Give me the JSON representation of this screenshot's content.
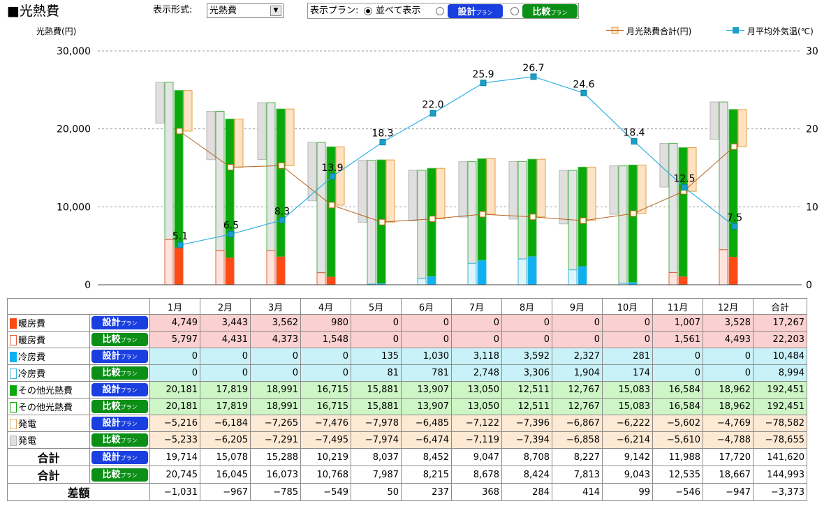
{
  "title": "■光熱費",
  "controls": {
    "display_format_label": "表示形式:",
    "display_format_value": "光熱費",
    "plan_label": "表示プラン:",
    "side_by_side_label": "並べて表示",
    "plan_design_main": "設計",
    "plan_compare_main": "比較",
    "plan_suffix": "プラン"
  },
  "chart_data": {
    "type": "bar",
    "ylabel": "光熱費(円)",
    "ylim": [
      0,
      30000
    ],
    "y2lim": [
      0,
      30
    ],
    "yticks": [
      "0",
      "10,000",
      "20,000",
      "30,000"
    ],
    "y2ticks": [
      "0",
      "10",
      "20",
      "30"
    ],
    "categories": [
      "1月",
      "2月",
      "3月",
      "4月",
      "5月",
      "6月",
      "7月",
      "8月",
      "9月",
      "10月",
      "11月",
      "12月"
    ],
    "legend": {
      "total": "月光熱費合計(円)",
      "temp": "月平均外気温(℃)",
      "position": "top-right"
    },
    "stacks": {
      "compare": {
        "heating": [
          5797,
          4431,
          4373,
          1548,
          0,
          0,
          0,
          0,
          0,
          0,
          1561,
          4493
        ],
        "cooling": [
          0,
          0,
          0,
          0,
          81,
          781,
          2748,
          3306,
          1904,
          174,
          0,
          0
        ],
        "other": [
          20181,
          17819,
          18991,
          16715,
          15881,
          13907,
          13050,
          12511,
          12767,
          15083,
          16584,
          18962
        ],
        "generation": [
          -5233,
          -6205,
          -7291,
          -7495,
          -7974,
          -6474,
          -7119,
          -7394,
          -6858,
          -6214,
          -5610,
          -4788
        ]
      },
      "design": {
        "heating": [
          4749,
          3443,
          3562,
          980,
          0,
          0,
          0,
          0,
          0,
          0,
          1007,
          3528
        ],
        "cooling": [
          0,
          0,
          0,
          0,
          135,
          1030,
          3118,
          3592,
          2327,
          281,
          0,
          0
        ],
        "other": [
          20181,
          17819,
          18991,
          16715,
          15881,
          13907,
          13050,
          12511,
          12767,
          15083,
          16584,
          18962
        ],
        "generation": [
          -5216,
          -6184,
          -7265,
          -7476,
          -7978,
          -6485,
          -7122,
          -7396,
          -6867,
          -6222,
          -5602,
          -4769
        ]
      }
    },
    "monthly_total_design": [
      19714,
      15078,
      15288,
      10219,
      8037,
      8452,
      9047,
      8708,
      8227,
      9142,
      11988,
      17720
    ],
    "monthly_total_compare": [
      20745,
      16045,
      16073,
      10768,
      7987,
      8215,
      8678,
      8424,
      7813,
      9043,
      12535,
      18667
    ],
    "temperature": [
      5.1,
      6.5,
      8.3,
      13.9,
      18.3,
      22.0,
      25.9,
      26.7,
      24.6,
      18.4,
      12.5,
      7.5
    ],
    "temperature_labels": [
      "5.1",
      "6.5",
      "8.3",
      "13.9",
      "18.3",
      "22.0",
      "25.9",
      "26.7",
      "24.6",
      "18.4",
      "12.5",
      "7.5"
    ],
    "grid": "horizontal dashed"
  },
  "colors": {
    "heating_design": "#ff4a14",
    "heating_compare": "#ffe3dc",
    "heating_compare_border": "#e0603a",
    "cooling_design": "#0fb0f0",
    "cooling_compare": "#dff4fb",
    "cooling_compare_border": "#39b6e0",
    "other_design": "#0aa80a",
    "other_compare": "#e4e4e4",
    "other_compare_border": "#48b848",
    "gen_design": "#fde2c3",
    "gen_design_border": "#e4a040",
    "gen_compare": "#e0dede",
    "gen_compare_border": "#b8b8b8",
    "total_line": "#b8631e",
    "temp_line": "#2fb0e4",
    "temp_marker": "#1aa0c8"
  },
  "table": {
    "headers": [
      "1月",
      "2月",
      "3月",
      "4月",
      "5月",
      "6月",
      "7月",
      "8月",
      "9月",
      "10月",
      "11月",
      "12月",
      "合計"
    ],
    "rows": [
      {
        "kind": "heat",
        "label": "暖房費",
        "swatch": "filled",
        "plan": "design",
        "values": [
          "4,749",
          "3,443",
          "3,562",
          "980",
          "0",
          "0",
          "0",
          "0",
          "0",
          "0",
          "1,007",
          "3,528",
          "17,267"
        ]
      },
      {
        "kind": "heat",
        "label": "暖房費",
        "swatch": "hollow",
        "plan": "compare",
        "values": [
          "5,797",
          "4,431",
          "4,373",
          "1,548",
          "0",
          "0",
          "0",
          "0",
          "0",
          "0",
          "1,561",
          "4,493",
          "22,203"
        ]
      },
      {
        "kind": "cool",
        "label": "冷房費",
        "swatch": "filled",
        "plan": "design",
        "values": [
          "0",
          "0",
          "0",
          "0",
          "135",
          "1,030",
          "3,118",
          "3,592",
          "2,327",
          "281",
          "0",
          "0",
          "10,484"
        ]
      },
      {
        "kind": "cool",
        "label": "冷房費",
        "swatch": "hollow",
        "plan": "compare",
        "values": [
          "0",
          "0",
          "0",
          "0",
          "81",
          "781",
          "2,748",
          "3,306",
          "1,904",
          "174",
          "0",
          "0",
          "8,994"
        ]
      },
      {
        "kind": "other",
        "label": "その他光熱費",
        "swatch": "filled",
        "plan": "design",
        "values": [
          "20,181",
          "17,819",
          "18,991",
          "16,715",
          "15,881",
          "13,907",
          "13,050",
          "12,511",
          "12,767",
          "15,083",
          "16,584",
          "18,962",
          "192,451"
        ]
      },
      {
        "kind": "other",
        "label": "その他光熱費",
        "swatch": "hollow",
        "plan": "compare",
        "values": [
          "20,181",
          "17,819",
          "18,991",
          "16,715",
          "15,881",
          "13,907",
          "13,050",
          "12,511",
          "12,767",
          "15,083",
          "16,584",
          "18,962",
          "192,451"
        ]
      },
      {
        "kind": "gen",
        "label": "発電",
        "swatch": "hollow",
        "plan": "design",
        "values": [
          "−5,216",
          "−6,184",
          "−7,265",
          "−7,476",
          "−7,978",
          "−6,485",
          "−7,122",
          "−7,396",
          "−6,867",
          "−6,222",
          "−5,602",
          "−4,769",
          "−78,582"
        ]
      },
      {
        "kind": "gen",
        "label": "発電",
        "swatch": "grey",
        "plan": "compare",
        "values": [
          "−5,233",
          "−6,205",
          "−7,291",
          "−7,495",
          "−7,974",
          "−6,474",
          "−7,119",
          "−7,394",
          "−6,858",
          "−6,214",
          "−5,610",
          "−4,788",
          "−78,655"
        ]
      },
      {
        "kind": "total",
        "label": "合計",
        "swatch": "none",
        "plan": "design",
        "values": [
          "19,714",
          "15,078",
          "15,288",
          "10,219",
          "8,037",
          "8,452",
          "9,047",
          "8,708",
          "8,227",
          "9,142",
          "11,988",
          "17,720",
          "141,620"
        ]
      },
      {
        "kind": "total",
        "label": "合計",
        "swatch": "none",
        "plan": "compare",
        "values": [
          "20,745",
          "16,045",
          "16,073",
          "10,768",
          "7,987",
          "8,215",
          "8,678",
          "8,424",
          "7,813",
          "9,043",
          "12,535",
          "18,667",
          "144,993"
        ]
      },
      {
        "kind": "diff",
        "label": "差額",
        "swatch": "none",
        "plan": "none",
        "values": [
          "−1,031",
          "−967",
          "−785",
          "−549",
          "50",
          "237",
          "368",
          "284",
          "414",
          "99",
          "−546",
          "−947",
          "−3,373"
        ]
      }
    ]
  }
}
